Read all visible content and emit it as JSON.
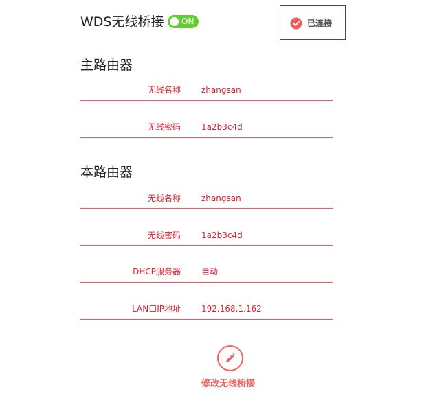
{
  "header": {
    "title": "WDS无线桥接",
    "toggle_label": "ON",
    "toggle_state": "on",
    "toggle_color": "#66cc33",
    "status_text": "已连接",
    "status_icon": "check-circle-icon",
    "status_icon_color": "#f05a5a"
  },
  "main_router": {
    "title": "主路由器",
    "rows": [
      {
        "key": "无线名称",
        "value": "zhangsan"
      },
      {
        "key": "无线密码",
        "value": "1a2b3c4d"
      }
    ]
  },
  "this_router": {
    "title": "本路由器",
    "rows": [
      {
        "key": "无线名称",
        "value": "zhangsan"
      },
      {
        "key": "无线密码",
        "value": "1a2b3c4d"
      },
      {
        "key": "DHCP服务器",
        "value": "自动"
      },
      {
        "key": "LAN口IP地址",
        "value": "192.168.1.162"
      }
    ]
  },
  "footer": {
    "edit_icon": "pencil-icon",
    "edit_label": "修改无线桥接",
    "accent": "#f06060"
  }
}
